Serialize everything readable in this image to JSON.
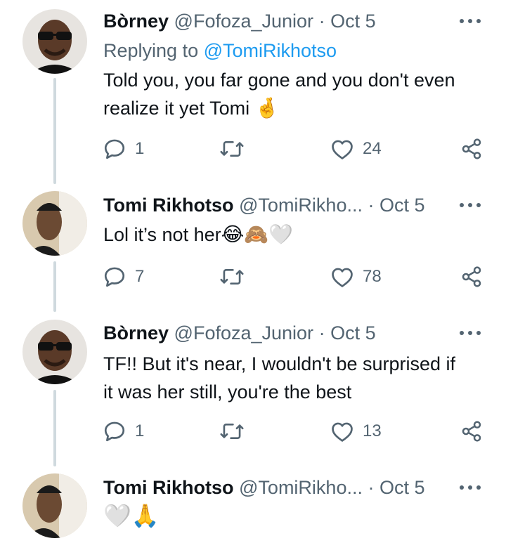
{
  "tweets": [
    {
      "name": "Bòrney",
      "handle": "@Fofoza_Junior",
      "time": "Oct 5",
      "replying_label": "Replying to",
      "replying_to": "@TomiRikhotso",
      "body_line1": "Told you, you far gone and you don't even",
      "body_line2": "realize it yet Tomi",
      "body_emoji": "🤞",
      "replies": "1",
      "retweets": "",
      "likes": "24"
    },
    {
      "name": "Tomi Rikhotso",
      "handle": "@TomiRikho...",
      "time": "Oct 5",
      "body_line1": "Lol it’s not her",
      "body_emoji": "😂🙈🤍",
      "replies": "7",
      "retweets": "",
      "likes": "78"
    },
    {
      "name": "Bòrney",
      "handle": "@Fofoza_Junior",
      "time": "Oct 5",
      "body_line1": "TF!! But it's near, I wouldn't be surprised if",
      "body_line2": "it was her still, you're the best",
      "replies": "1",
      "retweets": "",
      "likes": "13"
    },
    {
      "name": "Tomi Rikhotso",
      "handle": "@TomiRikho...",
      "time": "Oct 5",
      "body_emoji": "🤍🙏"
    }
  ],
  "separator": "·",
  "icons": {
    "reply": "reply-icon",
    "retweet": "retweet-icon",
    "like": "heart-icon",
    "share": "share-icon",
    "more": "more-icon"
  },
  "colors": {
    "link": "#1d9bf0",
    "muted": "#536471",
    "line": "#cfd9de"
  }
}
